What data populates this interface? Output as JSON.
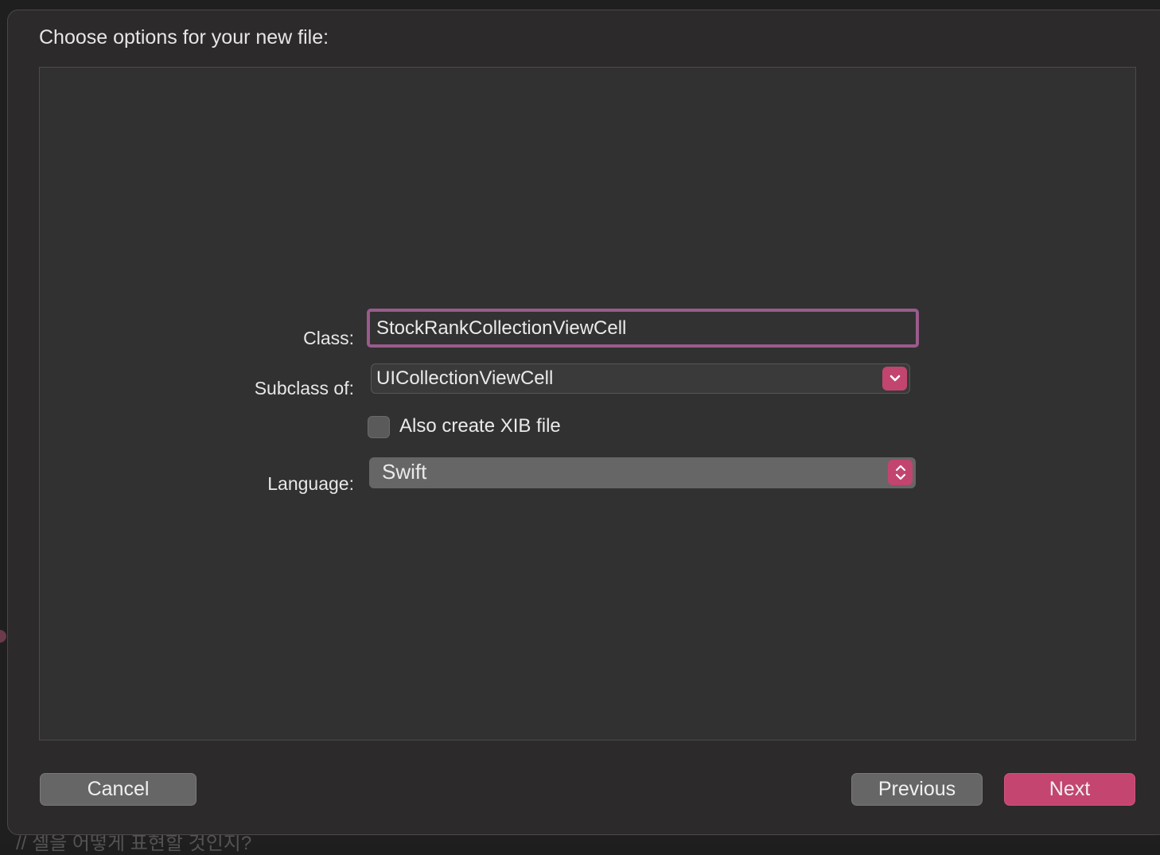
{
  "dialog": {
    "title": "Choose options for your new file:"
  },
  "form": {
    "class_label": "Class:",
    "class_value": "StockRankCollectionViewCell",
    "subclass_label": "Subclass of:",
    "subclass_value": "UICollectionViewCell",
    "xib_checkbox_label": "Also create XIB file",
    "xib_checkbox_checked": false,
    "language_label": "Language:",
    "language_value": "Swift"
  },
  "buttons": {
    "cancel": "Cancel",
    "previous": "Previous",
    "next": "Next"
  },
  "background": {
    "code_line": "// 셀을 어떻게 표현할 것인지?"
  },
  "colors": {
    "accent": "#c2456f",
    "focus_ring": "#9a5b8c",
    "sheet_background": "#2c2a2b"
  },
  "icons": {
    "subclass_popup": "chevron-down-icon",
    "language_popup": "up-down-chevron-icon"
  }
}
